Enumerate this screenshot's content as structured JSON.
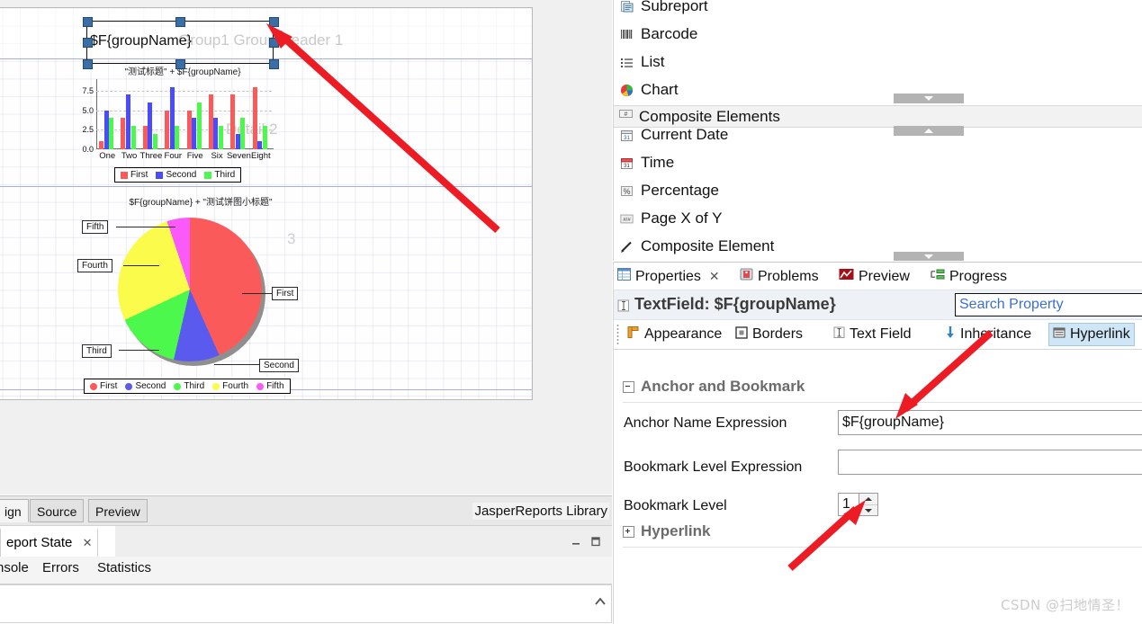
{
  "designer": {
    "selected_text_field": "$F{groupName}",
    "band_watermark_group": "Group1 Group Header 1",
    "band_watermark_detail": "Detail 2",
    "pie_band_number": "3"
  },
  "chart_data": [
    {
      "type": "bar",
      "title": "\"测试标题\" + $F{groupName}",
      "categories": [
        "One",
        "Two",
        "Three",
        "Four",
        "Five",
        "Six",
        "Seven",
        "Eight"
      ],
      "series": [
        {
          "name": "First",
          "color": "#fb5a5a",
          "values": [
            1,
            4,
            3,
            5,
            5,
            7,
            7,
            8
          ]
        },
        {
          "name": "Second",
          "color": "#4a4aff",
          "values": [
            5,
            7,
            6,
            8,
            4,
            4,
            2,
            1
          ]
        },
        {
          "name": "Third",
          "color": "#4cf84c",
          "values": [
            4,
            3,
            2,
            3,
            6,
            3,
            4,
            3
          ]
        }
      ],
      "yticks": [
        "7.5",
        "5.0",
        "2.5",
        "0.0"
      ],
      "ylim": [
        0,
        9
      ],
      "xlabel": "",
      "ylabel": "",
      "grid": true,
      "legend_position": "bottom"
    },
    {
      "type": "pie",
      "title": "$F{groupName} + \"测试饼图小标题\"",
      "labels": [
        "First",
        "Second",
        "Third",
        "Fourth",
        "Fifth"
      ],
      "values": [
        42,
        10,
        14,
        26,
        5
      ],
      "colors": [
        "#fb5a5a",
        "#5a5aee",
        "#4cf84c",
        "#fbfb4c",
        "#f95af9"
      ],
      "legend_position": "bottom"
    }
  ],
  "design_tabs": {
    "items": [
      {
        "label": "ign",
        "selected": true
      },
      {
        "label": "Source",
        "selected": false
      },
      {
        "label": "Preview",
        "selected": false
      }
    ],
    "library_label": "JasperReports Library"
  },
  "report_state": {
    "tab_label": "eport State",
    "close_icon": "close-icon",
    "minimize_icon": "minimize-icon",
    "maximize_icon": "maximize-icon"
  },
  "console_tabs": [
    "nsole",
    "Errors",
    "Statistics"
  ],
  "palette": {
    "items": [
      {
        "label": "Subreport",
        "icon": "subreport-icon"
      },
      {
        "label": "Barcode",
        "icon": "barcode-icon"
      },
      {
        "label": "List",
        "icon": "list-icon"
      },
      {
        "label": "Chart",
        "icon": "pie-chart-icon"
      }
    ],
    "section": {
      "label": "Composite Elements",
      "icon": "hash-icon"
    },
    "composite_items": [
      {
        "label": "Current Date",
        "icon": "calendar-icon"
      },
      {
        "label": "Time",
        "icon": "calendar-clock-icon"
      },
      {
        "label": "Percentage",
        "icon": "percent-icon"
      },
      {
        "label": "Page X of Y",
        "icon": "page-number-icon"
      },
      {
        "label": "Composite Element",
        "icon": "pen-icon"
      }
    ],
    "scroll_buttons": [
      {
        "name": "scroll-down-top",
        "direction": "down"
      },
      {
        "name": "scroll-up",
        "direction": "up"
      },
      {
        "name": "scroll-down-bottom",
        "direction": "down"
      }
    ]
  },
  "properties": {
    "view_tabs": [
      {
        "label": "Properties",
        "icon": "properties-icon",
        "active": true,
        "closable": true
      },
      {
        "label": "Problems",
        "icon": "problems-icon",
        "active": false,
        "closable": false
      },
      {
        "label": "Preview",
        "icon": "preview-icon",
        "active": false,
        "closable": false
      },
      {
        "label": "Progress",
        "icon": "progress-icon",
        "active": false,
        "closable": false
      }
    ],
    "title": "TextField: $F{groupName}",
    "search": {
      "placeholder": "Search Property",
      "value": "Search Property"
    },
    "tabs": [
      {
        "label": "Appearance",
        "icon": "appearance-icon",
        "selected": false
      },
      {
        "label": "Borders",
        "icon": "borders-icon",
        "selected": false
      },
      {
        "label": "Text Field",
        "icon": "text-field-icon",
        "selected": false
      },
      {
        "label": "Inheritance",
        "icon": "inheritance-icon",
        "selected": false
      },
      {
        "label": "Hyperlink",
        "icon": "hyperlink-icon",
        "selected": true
      }
    ],
    "sections": {
      "anchor_bookmark": {
        "label": "Anchor and Bookmark",
        "expanded": true,
        "rows": [
          {
            "label": "Anchor Name Expression",
            "value": "$F{groupName}"
          },
          {
            "label": "Bookmark Level Expression",
            "value": ""
          },
          {
            "label": "Bookmark Level",
            "value": "1"
          }
        ]
      },
      "hyperlink": {
        "label": "Hyperlink",
        "expanded": false
      }
    }
  },
  "watermark": "CSDN @扫地情圣！",
  "colors": {
    "accent_red": "#ed1c24",
    "selection_blue": "#3b6ea5",
    "tab_highlight": "#cfe6f7"
  }
}
